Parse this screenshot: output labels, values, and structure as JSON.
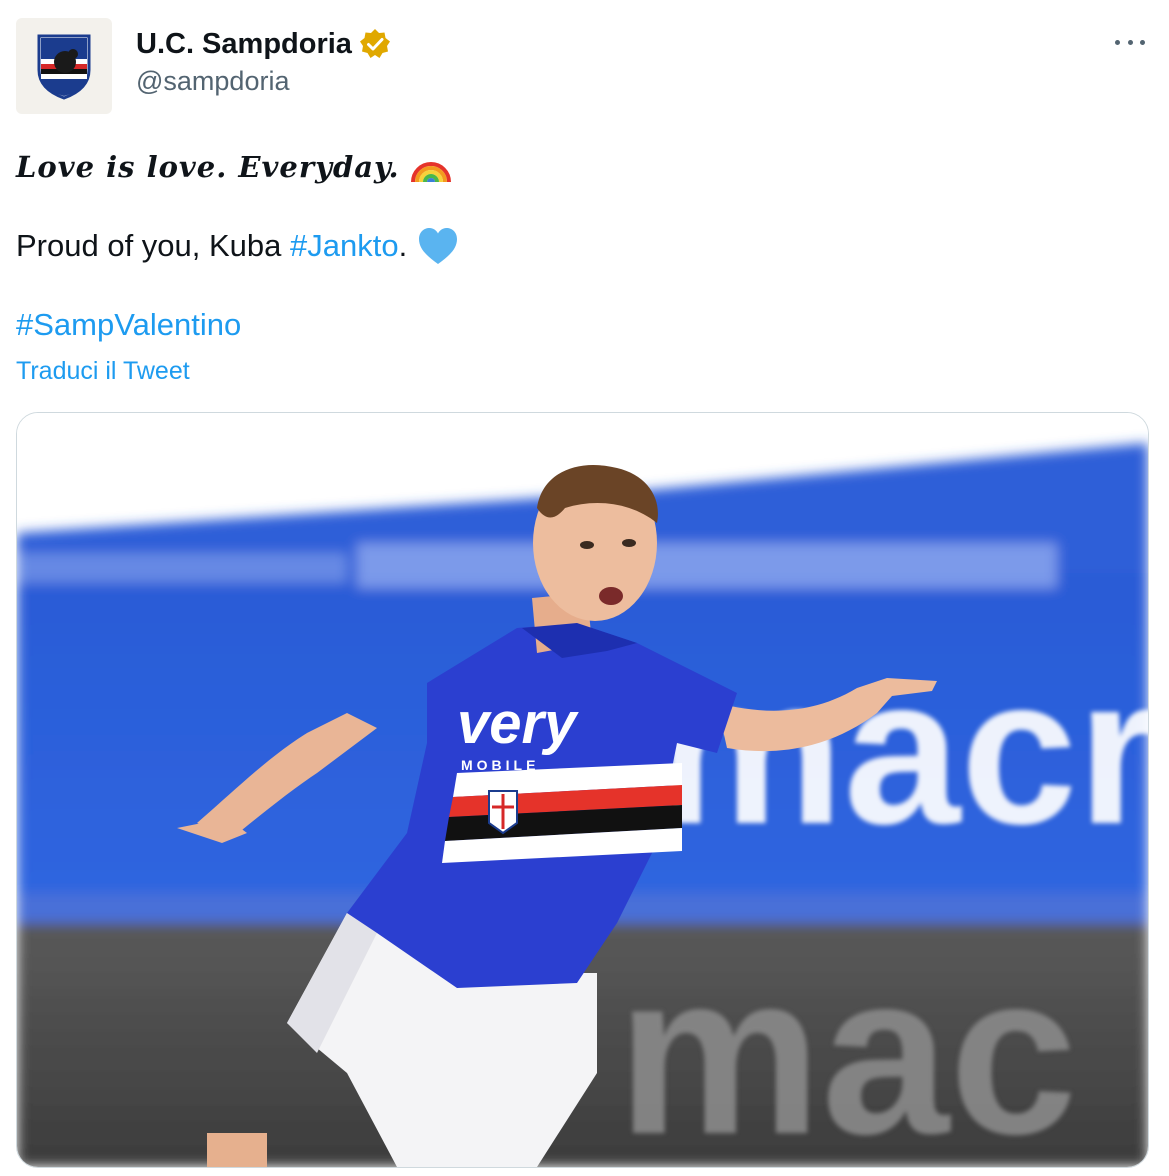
{
  "account": {
    "display_name": "U.C. Sampdoria",
    "handle": "@sampdoria",
    "avatar_icon": "sampdoria-crest-icon",
    "verified_color": "#e0a800"
  },
  "tweet": {
    "line1": "Love is love. Everyday.",
    "line2_prefix": "Proud of you, Kuba ",
    "hashtag1": "#Jankto",
    "line2_suffix": ".",
    "hashtag2": "#SampValentino",
    "translate": "Traduci il Tweet",
    "emoji_rainbow": "rainbow-icon",
    "emoji_heart": "blue-heart-icon"
  },
  "media": {
    "jersey_sponsor": "very",
    "jersey_sponsor_sub": "MOBILE",
    "background_banner_text": "macr",
    "lower_banner_text": "mac",
    "image_description_colors": {
      "sky": "#ffffff",
      "stand_blue": "#2f5fd8",
      "jersey_blue": "#2b3fd0",
      "link": "#1d9bf0"
    }
  },
  "colors": {
    "accent": "#1d9bf0",
    "text": "#0f1419",
    "secondary": "#536471",
    "heart": "#5ab4f0"
  }
}
